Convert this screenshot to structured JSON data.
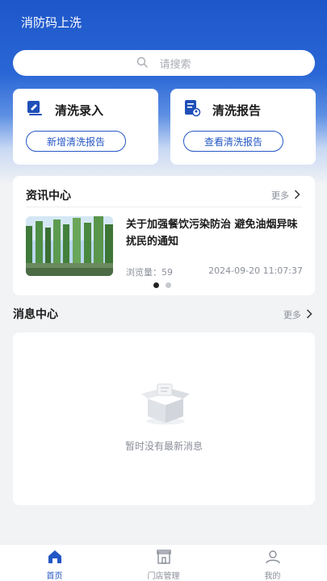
{
  "header": {
    "app_title": "消防码上洗"
  },
  "search": {
    "placeholder": "请搜索",
    "icon": "search-icon"
  },
  "quick_actions": [
    {
      "title": "清洗录入",
      "button": "新增清洗报告",
      "icon": "entry-icon"
    },
    {
      "title": "清洗报告",
      "button": "查看清洗报告",
      "icon": "report-icon"
    }
  ],
  "news": {
    "title": "资讯中心",
    "more": "更多",
    "item": {
      "title": "关于加强餐饮污染防治 避免油烟异味扰民的通知",
      "views_label": "浏览量：",
      "views": "59",
      "timestamp": "2024-09-20 11:07:37"
    },
    "carousel": {
      "count": 2,
      "active": 0
    }
  },
  "messages": {
    "title": "消息中心",
    "more": "更多",
    "empty_text": "暂时没有最新消息"
  },
  "tabbar": {
    "items": [
      {
        "label": "首页",
        "icon": "home-icon",
        "active": true
      },
      {
        "label": "门店管理",
        "icon": "store-icon",
        "active": false
      },
      {
        "label": "我的",
        "icon": "profile-icon",
        "active": false
      }
    ]
  },
  "colors": {
    "primary": "#2457c5",
    "header_bg": "#1d56c9",
    "page_bg": "#f2f3f5"
  }
}
